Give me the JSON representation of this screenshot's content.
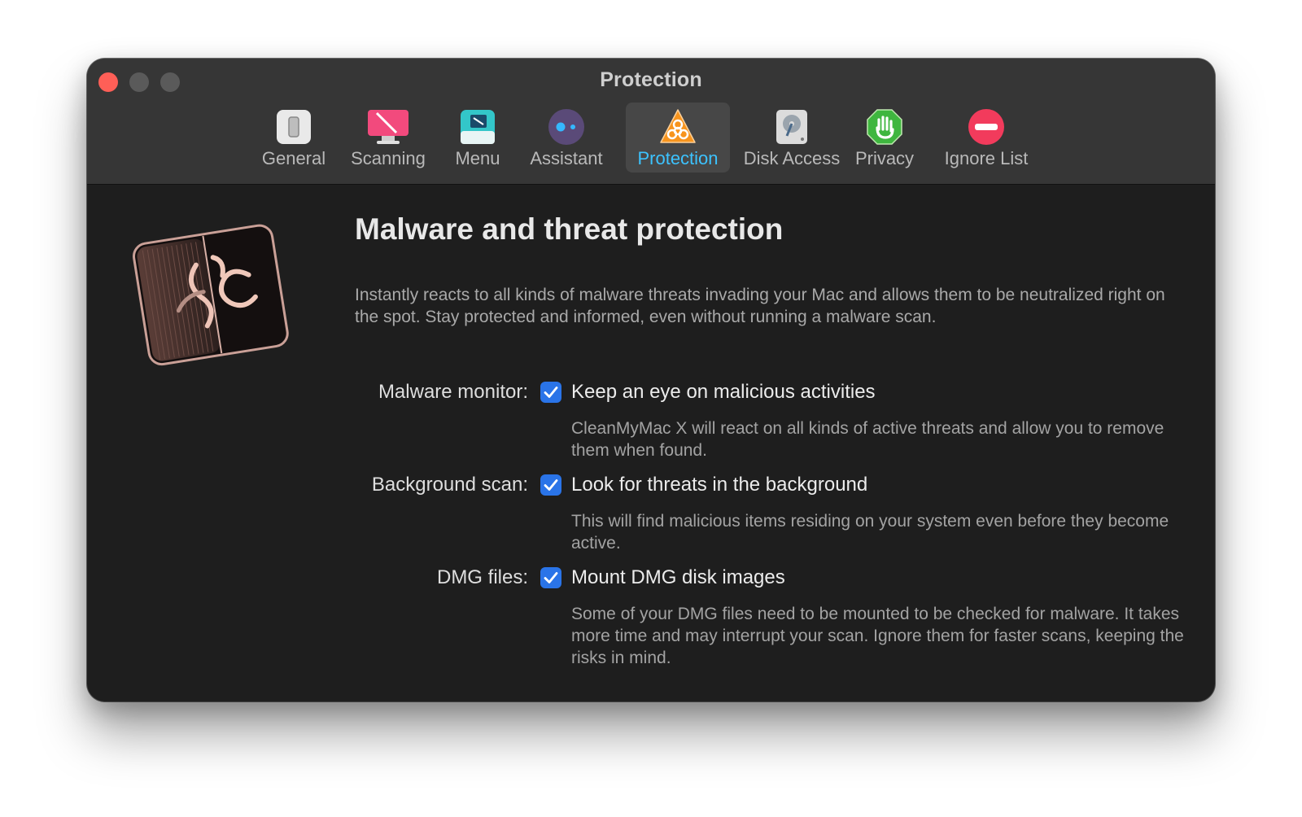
{
  "window": {
    "title": "Protection"
  },
  "toolbar": {
    "tabs": [
      {
        "id": "general",
        "label": "General",
        "icon": "switch-icon"
      },
      {
        "id": "scanning",
        "label": "Scanning",
        "icon": "monitor-icon"
      },
      {
        "id": "menu",
        "label": "Menu",
        "icon": "menu-icon"
      },
      {
        "id": "assistant",
        "label": "Assistant",
        "icon": "assistant-icon"
      },
      {
        "id": "protection",
        "label": "Protection",
        "icon": "biohazard-icon",
        "active": true
      },
      {
        "id": "disk-access",
        "label": "Disk Access",
        "icon": "disk-icon"
      },
      {
        "id": "privacy",
        "label": "Privacy",
        "icon": "hand-icon"
      },
      {
        "id": "ignore-list",
        "label": "Ignore List",
        "icon": "no-entry-icon"
      }
    ]
  },
  "main": {
    "heading": "Malware and threat protection",
    "intro": "Instantly reacts to all kinds of malware threats invading your Mac and allows them to be neutralized right on the spot. Stay protected and informed, even without running a malware scan.",
    "options": [
      {
        "label": "Malware monitor:",
        "checked": true,
        "title": "Keep an eye on malicious activities",
        "description": "CleanMyMac X will react on all kinds of active threats and allow you to remove them when found."
      },
      {
        "label": "Background scan:",
        "checked": true,
        "title": "Look for threats in the background",
        "description": "This will find malicious items residing on your system even before they become active."
      },
      {
        "label": "DMG files:",
        "checked": true,
        "title": "Mount DMG disk images",
        "description": "Some of your DMG files need to be mounted to be checked for malware. It takes more time and may interrupt your scan. Ignore them for faster scans, keeping the risks in mind."
      }
    ]
  },
  "colors": {
    "accent": "#3cc3ff",
    "checkbox": "#2a74e8",
    "close": "#fe5f57"
  }
}
